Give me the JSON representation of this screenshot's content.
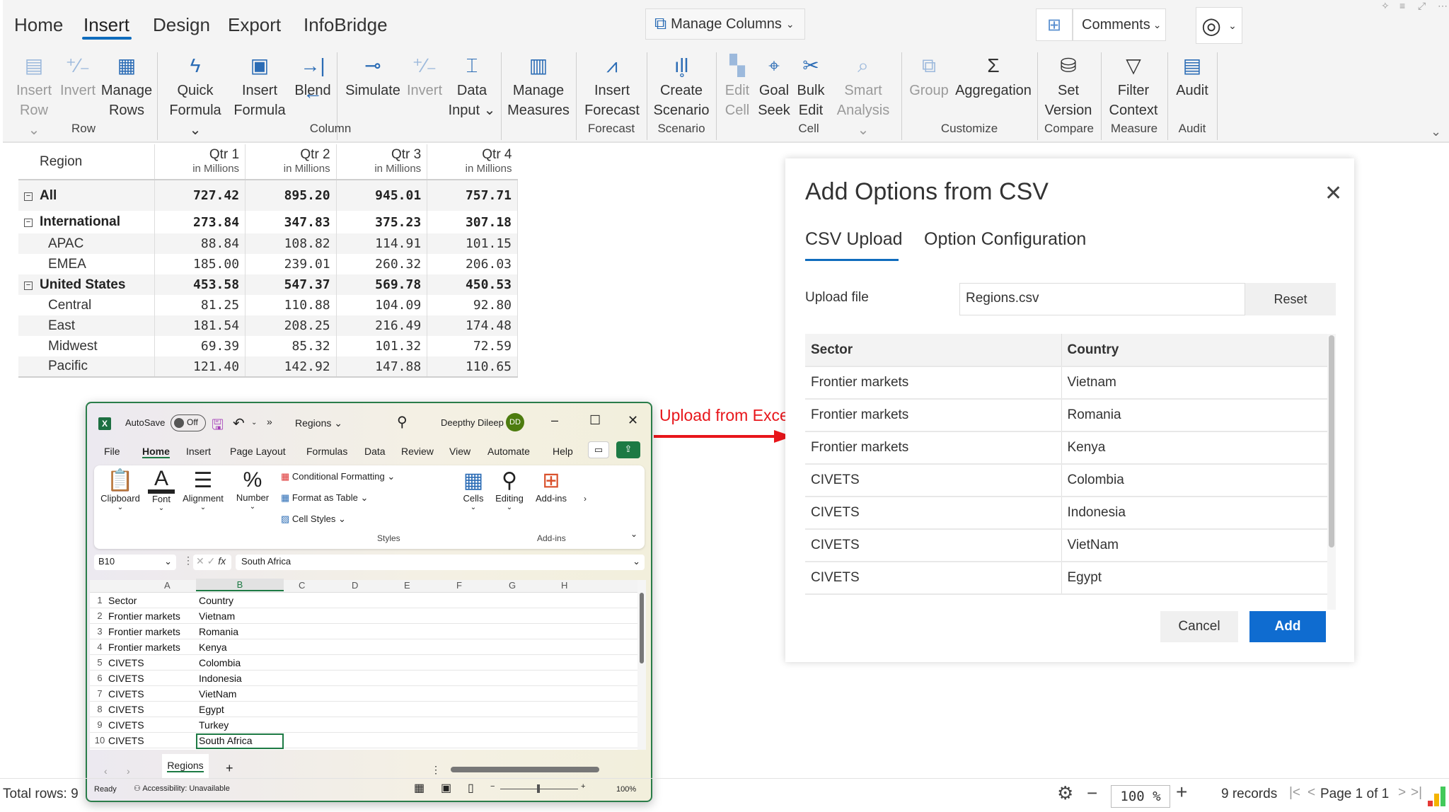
{
  "ribbon": {
    "tabs": [
      "Home",
      "Insert",
      "Design",
      "Export",
      "InfoBridge"
    ],
    "active_tab": "Insert",
    "manage_columns": "Manage Columns",
    "comments": "Comments",
    "buttons": {
      "insert_row": [
        "Insert",
        "Row"
      ],
      "invert1": [
        "Invert",
        ""
      ],
      "manage_rows": [
        "Manage",
        "Rows"
      ],
      "quick_formula": [
        "Quick",
        "Formula"
      ],
      "insert_formula": [
        "Insert",
        "Formula"
      ],
      "blend": [
        "Blend",
        ""
      ],
      "simulate": [
        "Simulate",
        ""
      ],
      "invert2": [
        "Invert",
        ""
      ],
      "data_input": [
        "Data",
        "Input"
      ],
      "manage_measures": [
        "Manage",
        "Measures"
      ],
      "insert_forecast": [
        "Insert",
        "Forecast"
      ],
      "create_scenario": [
        "Create",
        "Scenario"
      ],
      "edit_cell": [
        "Edit",
        "Cell"
      ],
      "goal_seek": [
        "Goal",
        "Seek"
      ],
      "bulk_edit": [
        "Bulk",
        "Edit"
      ],
      "smart_analysis": [
        "Smart",
        "Analysis"
      ],
      "group": [
        "Group",
        ""
      ],
      "aggregation": [
        "Aggregation",
        ""
      ],
      "set_version": [
        "Set",
        "Version"
      ],
      "filter_context": [
        "Filter",
        "Context"
      ],
      "audit": [
        "Audit",
        ""
      ]
    },
    "groups": [
      "Row",
      "Column",
      "Forecast",
      "Scenario",
      "Cell",
      "Customize",
      "Compare",
      "Measure",
      "Audit"
    ]
  },
  "grid": {
    "region_header": "Region",
    "columns": [
      {
        "label": "Qtr 1",
        "sub": "in Millions"
      },
      {
        "label": "Qtr 2",
        "sub": "in Millions"
      },
      {
        "label": "Qtr 3",
        "sub": "in Millions"
      },
      {
        "label": "Qtr 4",
        "sub": "in Millions"
      }
    ],
    "rows": [
      {
        "name": "All",
        "values": [
          "727.42",
          "895.20",
          "945.01",
          "757.71"
        ]
      },
      {
        "name": "International",
        "values": [
          "273.84",
          "347.83",
          "375.23",
          "307.18"
        ]
      },
      {
        "name": "APAC",
        "values": [
          "88.84",
          "108.82",
          "114.91",
          "101.15"
        ]
      },
      {
        "name": "EMEA",
        "values": [
          "185.00",
          "239.01",
          "260.32",
          "206.03"
        ]
      },
      {
        "name": "United States",
        "values": [
          "453.58",
          "547.37",
          "569.78",
          "450.53"
        ]
      },
      {
        "name": "Central",
        "values": [
          "81.25",
          "110.88",
          "104.09",
          "92.80"
        ]
      },
      {
        "name": "East",
        "values": [
          "181.54",
          "208.25",
          "216.49",
          "174.48"
        ]
      },
      {
        "name": "Midwest",
        "values": [
          "69.39",
          "85.32",
          "101.32",
          "72.59"
        ]
      },
      {
        "name": "Pacific",
        "values": [
          "121.40",
          "142.92",
          "147.88",
          "110.65"
        ]
      }
    ]
  },
  "annotation": "Upload from Excel",
  "dialog": {
    "title": "Add Options from CSV",
    "tabs": [
      "CSV Upload",
      "Option Configuration"
    ],
    "upload_label": "Upload file",
    "upload_value": "Regions.csv",
    "reset": "Reset",
    "headers": [
      "Sector",
      "Country"
    ],
    "rows": [
      [
        "Frontier markets",
        "Vietnam"
      ],
      [
        "Frontier markets",
        "Romania"
      ],
      [
        "Frontier markets",
        "Kenya"
      ],
      [
        "CIVETS",
        "Colombia"
      ],
      [
        "CIVETS",
        "Indonesia"
      ],
      [
        "CIVETS",
        "VietNam"
      ],
      [
        "CIVETS",
        "Egypt"
      ]
    ],
    "cancel": "Cancel",
    "add": "Add"
  },
  "excel": {
    "autosave": "AutoSave",
    "autosave_state": "Off",
    "filename": "Regions",
    "user": "Deepthy Dileep",
    "user_initials": "DD",
    "menu": [
      "File",
      "Home",
      "Insert",
      "Page Layout",
      "Formulas",
      "Data",
      "Review",
      "View",
      "Automate",
      "Help"
    ],
    "ribbon": {
      "clipboard": "Clipboard",
      "font": "Font",
      "alignment": "Alignment",
      "number": "Number",
      "cond_format": "Conditional Formatting",
      "format_table": "Format as Table",
      "cell_styles": "Cell Styles",
      "styles": "Styles",
      "cells": "Cells",
      "editing": "Editing",
      "addins": "Add-ins",
      "addins_group": "Add-ins"
    },
    "namebox": "B10",
    "formula": "South Africa",
    "col_headers": [
      "A",
      "B",
      "C",
      "D",
      "E",
      "F",
      "G",
      "H"
    ],
    "rows": [
      [
        "Sector",
        "Country"
      ],
      [
        "Frontier markets",
        "Vietnam"
      ],
      [
        "Frontier markets",
        "Romania"
      ],
      [
        "Frontier markets",
        "Kenya"
      ],
      [
        "CIVETS",
        "Colombia"
      ],
      [
        "CIVETS",
        "Indonesia"
      ],
      [
        "CIVETS",
        "VietNam"
      ],
      [
        "CIVETS",
        "Egypt"
      ],
      [
        "CIVETS",
        "Turkey"
      ],
      [
        "CIVETS",
        "South Africa"
      ]
    ],
    "sheet": "Regions",
    "status_ready": "Ready",
    "accessibility": "Accessibility: Unavailable",
    "zoom": "100%"
  },
  "status": {
    "total_rows": "Total rows: 9",
    "zoom": "100 %",
    "records": "9 records",
    "page": "Page 1 of 1"
  }
}
